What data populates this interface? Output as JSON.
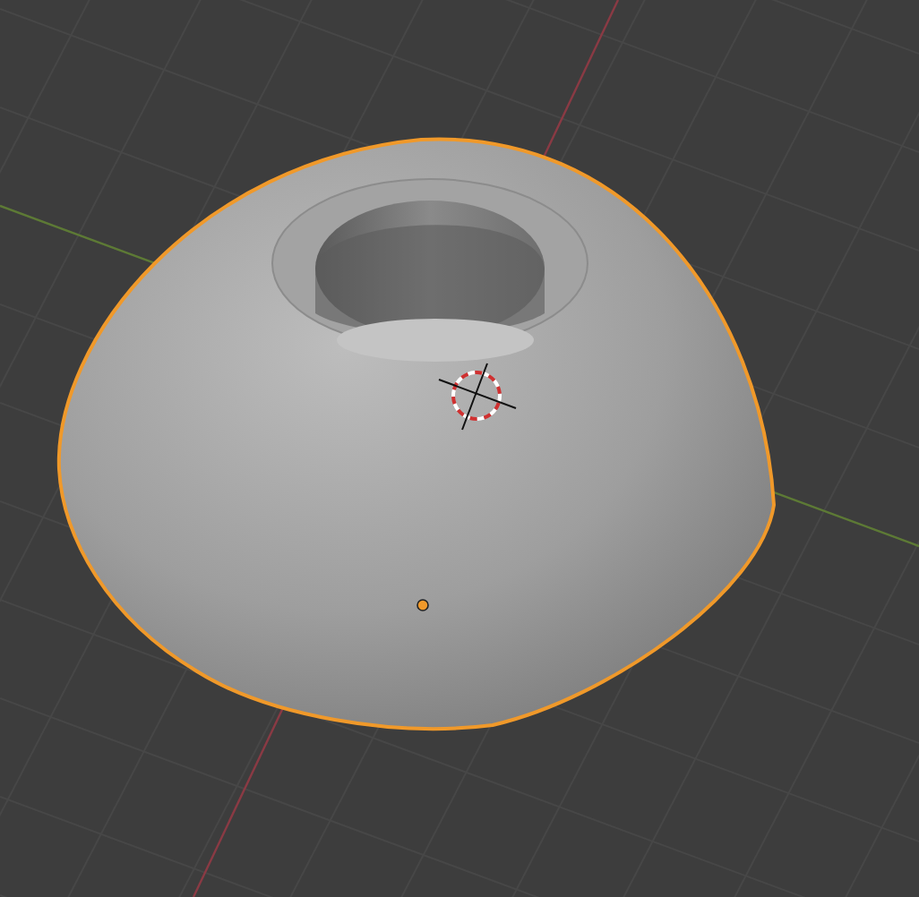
{
  "viewport": {
    "object": {
      "selected": true
    }
  }
}
